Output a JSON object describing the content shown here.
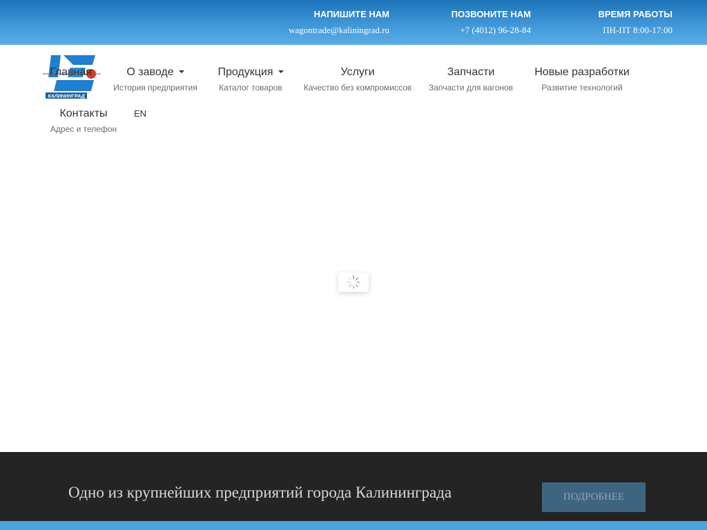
{
  "contacts": [
    {
      "title": "НАПИШИТЕ НАМ",
      "value": "wagontrade@kaliningrad.ru"
    },
    {
      "title": "ПОЗВОНИТЕ НАМ",
      "value": "+7 (4012) 96-28-84"
    },
    {
      "title": "ВРЕМЯ РАБОТЫ",
      "value": "ПН-ПТ 8:00-17:00"
    }
  ],
  "logo": {
    "text": "КАЛИНИНГРАД"
  },
  "nav": {
    "home": {
      "label": "Главная"
    },
    "about": {
      "label": "О заводе",
      "sub": "История предприятия"
    },
    "products": {
      "label": "Продукция",
      "sub": "Каталог товаров"
    },
    "services": {
      "label": "Услуги",
      "sub": "Качество без компромиссов"
    },
    "parts": {
      "label": "Запчасти",
      "sub": "Запчасти для вагонов"
    },
    "new": {
      "label": "Новые разработки",
      "sub": "Развитие технологий"
    },
    "contacts": {
      "label": "Контакты",
      "sub": "Адрес и телефон"
    },
    "lang": "EN"
  },
  "banner": {
    "text": "Одно из крупнейших предприятий города Калининграда",
    "button": "ПОДРОБНЕЕ"
  },
  "colors": {
    "topbar": "#3f97d8",
    "banner_bg": "#242424",
    "button_bg": "#3e6580",
    "logo_blue": "#1f7fd0",
    "logo_red": "#d93a1e"
  }
}
